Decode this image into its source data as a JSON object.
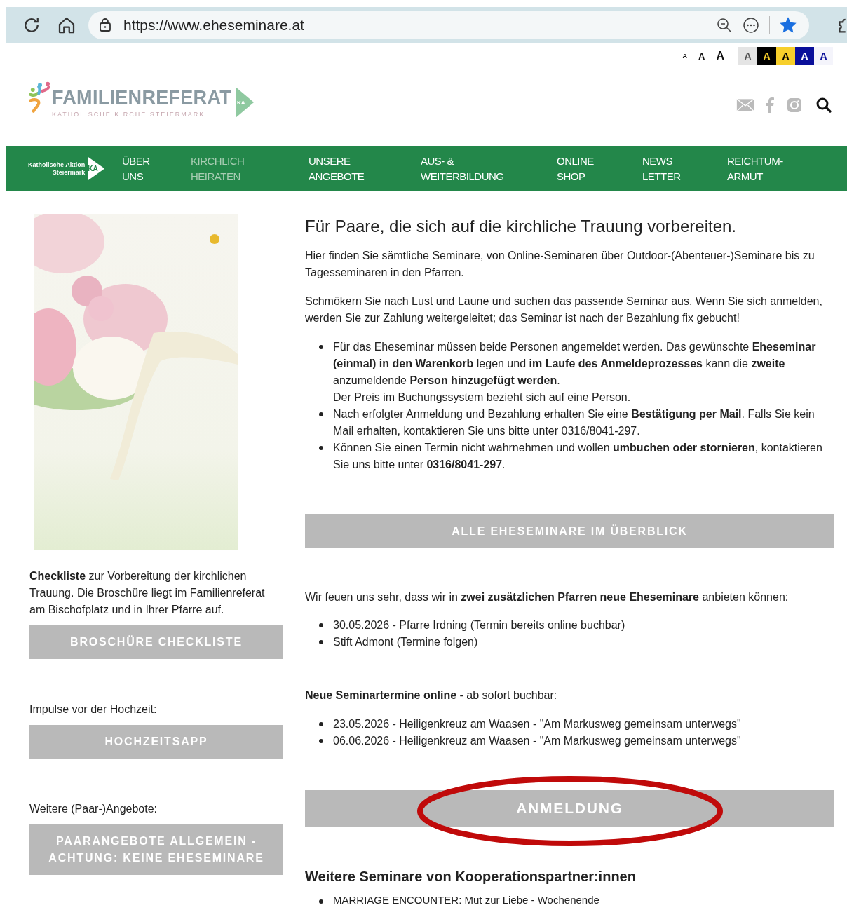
{
  "browser": {
    "url": "https://www.eheseminare.at",
    "bookmarked": true
  },
  "font_sizes": [
    {
      "label": "A",
      "kind": "small"
    },
    {
      "label": "A",
      "kind": "medium"
    },
    {
      "label": "A",
      "kind": "large"
    }
  ],
  "contrast_options": [
    {
      "label": "A",
      "kind": "default"
    },
    {
      "label": "A",
      "kind": "black-yellow"
    },
    {
      "label": "A",
      "kind": "yellow-black"
    },
    {
      "label": "A",
      "kind": "blue-white"
    },
    {
      "label": "A",
      "kind": "white-blue"
    }
  ],
  "logo": {
    "name": "FAMILIENREFERAT",
    "subtitle": "KATHOLISCHE KIRCHE STEIERMARK",
    "badge": "KA"
  },
  "nav": {
    "logo": {
      "name": "Katholische Aktion\nSteiermark",
      "badge": "KA"
    },
    "items": [
      {
        "label": "ÜBER\nUNS",
        "selected": false
      },
      {
        "label": "KIRCHLICH\nHEIRATEN",
        "selected": true
      },
      {
        "label": "UNSERE\nANGEBOTE",
        "selected": false
      },
      {
        "label": "AUS- &\nWEITERBILDUNG",
        "selected": false
      },
      {
        "label": "ONLINE\nSHOP",
        "selected": false
      },
      {
        "label": "NEWS\nLETTER",
        "selected": false
      },
      {
        "label": "REICHTUM-\nARMUT",
        "selected": false
      }
    ]
  },
  "sidebar": {
    "blocks": [
      {
        "text": "**Checkliste** zur Vorbereitung der kirchlichen Trauung. Die Broschüre liegt im Familienreferat am Bischofplatz und in Ihrer Pfarre auf.",
        "button": "BROSCHÜRE CHECKLISTE"
      },
      {
        "text": "Impulse vor der Hochzeit:",
        "button": "HOCHZEITSAPP"
      },
      {
        "text": "Weitere (Paar-)Angebote:",
        "button": "PAARANGEBOTE ALLGEMEIN -\nACHTUNG: KEINE EHESEMINARE"
      }
    ]
  },
  "main": {
    "heading": "Für Paare, die sich auf die kirchliche Trauung vorbereiten.",
    "sections": [
      {
        "paragraphs": [
          "Hier finden Sie sämtliche Seminare, von Online-Seminaren über Outdoor-(Abenteuer-)Seminare bis zu Tagesseminaren in den Pfarren.",
          "Schmökern Sie nach Lust und Laune und suchen das passende Seminar aus. Wenn Sie sich anmelden, werden Sie zur Zahlung weitergeleitet; das Seminar ist nach der Bezahlung fix gebucht!"
        ],
        "bullets": [
          "Für das Eheseminar müssen beide Personen angemeldet werden. Das gewünschte **Eheseminar (einmal) in den Warenkorb** legen und **im Laufe des Anmeldeprozesses** kann die **zweite** anzumeldende **Person hinzugefügt werden**.\nDer Preis im Buchungssystem bezieht sich auf eine Person.",
          "Nach erfolgter Anmeldung und Bezahlung erhalten Sie eine **Bestätigung per Mail**. Falls Sie kein Mail erhalten, kontaktieren Sie uns bitte unter 0316/8041-297.",
          "Können Sie einen Termin nicht wahrnehmen und wollen **umbuchen oder stornieren**, kontaktieren Sie uns bitte unter **0316/8041-297**."
        ],
        "button": {
          "label": "ALLE EHESEMINARE IM ÜBERBLICK",
          "circled": false
        }
      },
      {
        "paragraphs": [
          "Wir feuen uns sehr, dass wir in **zwei zusätzlichen Pfarren neue Eheseminare** anbieten können:"
        ],
        "bullets": [
          "30.05.2026 - Pfarre Irdning (Termin bereits online buchbar)",
          "Stift Admont (Termine folgen)"
        ]
      },
      {
        "paragraphs": [
          "**Neue Seminartermine online** - ab sofort buchbar:"
        ],
        "bullets": [
          "23.05.2026 - Heiligenkreuz am Waasen - \"Am Markusweg gemeinsam unterwegs\"",
          "06.06.2026 - Heiligenkreuz am Waasen - \"Am Markusweg gemeinsam unterwegs\""
        ],
        "button": {
          "label": "ANMELDUNG",
          "circled": true
        }
      }
    ],
    "partners": {
      "heading": "Weitere Seminare von Kooperationspartner:innen",
      "bullets": [
        "MARRIAGE ENCOUNTER: Mut zur Liebe - Wochenende"
      ]
    }
  }
}
